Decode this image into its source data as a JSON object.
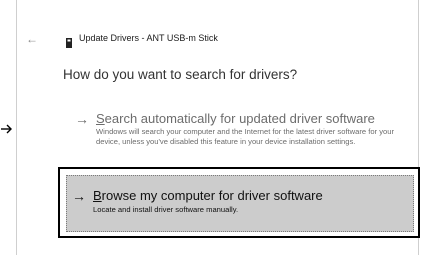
{
  "window": {
    "back_glyph": "←",
    "title": "Update Drivers - ANT USB-m Stick",
    "title_icon": "usb-device-icon"
  },
  "main": {
    "heading": "How do you want to search for drivers?",
    "options": [
      {
        "accel": "S",
        "title_rest": "earch automatically for updated driver software",
        "description": "Windows will search your computer and the Internet for the latest driver software for your device, unless you've disabled this feature in your device installation settings.",
        "state": "disabled"
      },
      {
        "accel": "B",
        "title_rest": "rowse my computer for driver software",
        "description": "Locate and install driver software manually.",
        "state": "highlighted"
      }
    ]
  },
  "colors": {
    "disabled_text": "#6c6c6c",
    "highlight_bg": "#cccccc",
    "highlight_border": "#000000"
  }
}
